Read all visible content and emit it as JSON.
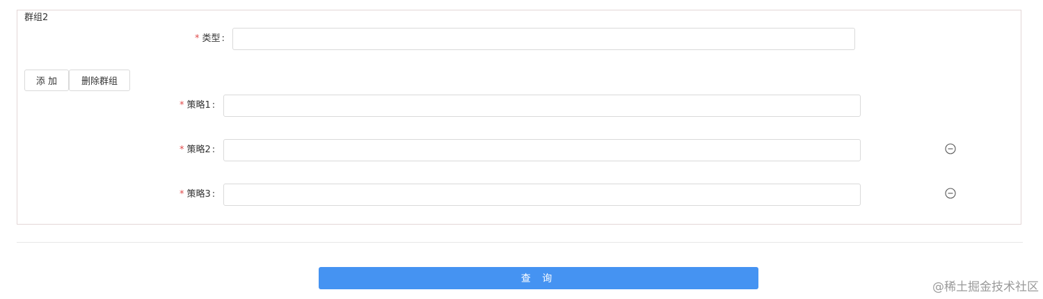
{
  "group": {
    "title": "群组2",
    "type_field": {
      "required_mark": "*",
      "label": "类型",
      "colon": ":",
      "value": "",
      "placeholder": ""
    },
    "add_button_label": "添 加",
    "delete_group_button_label": "删除群组",
    "strategies": [
      {
        "required_mark": "*",
        "label": "策略1",
        "colon": ":",
        "value": "",
        "placeholder": ""
      },
      {
        "required_mark": "*",
        "label": "策略2",
        "colon": ":",
        "value": "",
        "placeholder": "",
        "remove_icon": "minus-circle-icon"
      },
      {
        "required_mark": "*",
        "label": "策略3",
        "colon": ":",
        "value": "",
        "placeholder": "",
        "remove_icon": "minus-circle-icon"
      }
    ]
  },
  "query_button_label": "查 询",
  "watermark_credit": "@稀土掘金技术社区",
  "colors": {
    "primary": "#4593f2",
    "required": "#e04a4a",
    "border": "#d9d9d9"
  }
}
